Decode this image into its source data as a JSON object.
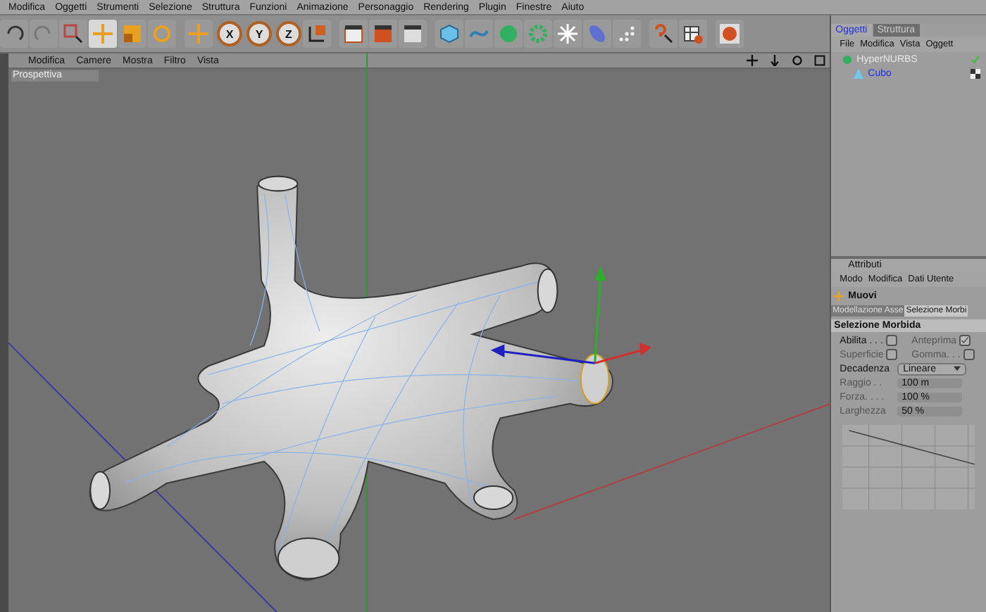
{
  "menu_bar": [
    "Modifica",
    "Oggetti",
    "Strumenti",
    "Selezione",
    "Struttura",
    "Funzioni",
    "Animazione",
    "Personaggio",
    "Rendering",
    "Plugin",
    "Finestre",
    "Aiuto"
  ],
  "toolbar": {
    "axis_locks": [
      "X",
      "Y",
      "Z"
    ]
  },
  "viewport": {
    "menu": [
      "Modifica",
      "Camere",
      "Mostra",
      "Filtro",
      "Vista"
    ],
    "camera_label": "Prospettiva"
  },
  "object_manager": {
    "tabs": [
      {
        "label": "Oggetti",
        "selected": true
      },
      {
        "label": "Struttura",
        "selected": false
      }
    ],
    "menu": [
      "File",
      "Modifica",
      "Vista",
      "Oggett"
    ],
    "tree": [
      {
        "name": "HyperNURBS",
        "selected": false,
        "children": [
          {
            "name": "Cubo",
            "selected": true
          }
        ]
      }
    ]
  },
  "attributes": {
    "title": "Attributi",
    "menu": [
      "Modo",
      "Modifica",
      "Dati Utente"
    ],
    "tool": "Muovi",
    "tabs": [
      {
        "label": "Modellazione Asse",
        "selected": false
      },
      {
        "label": "Selezione Morbi",
        "selected": true
      }
    ],
    "section": "Selezione Morbida",
    "rows": [
      {
        "kind": "checkboxes",
        "items": [
          {
            "label": "Abilita . . .",
            "checked": false,
            "disabled": false
          },
          {
            "label": "Anteprima",
            "checked": true,
            "disabled": true
          }
        ]
      },
      {
        "kind": "checkboxes",
        "items": [
          {
            "label": "Superficie",
            "checked": false,
            "disabled": true
          },
          {
            "label": "Gomma. . .",
            "checked": false,
            "disabled": true
          }
        ]
      },
      {
        "kind": "dropdown",
        "label": "Decadenza",
        "value": "Lineare",
        "disabled": false
      },
      {
        "kind": "number",
        "label": "Raggio . .",
        "value": "100 m",
        "disabled": true
      },
      {
        "kind": "number",
        "label": "Forza. . . .",
        "value": "100 %",
        "disabled": true
      },
      {
        "kind": "number",
        "label": "Larghezza",
        "value": "50 %",
        "disabled": true
      }
    ]
  }
}
